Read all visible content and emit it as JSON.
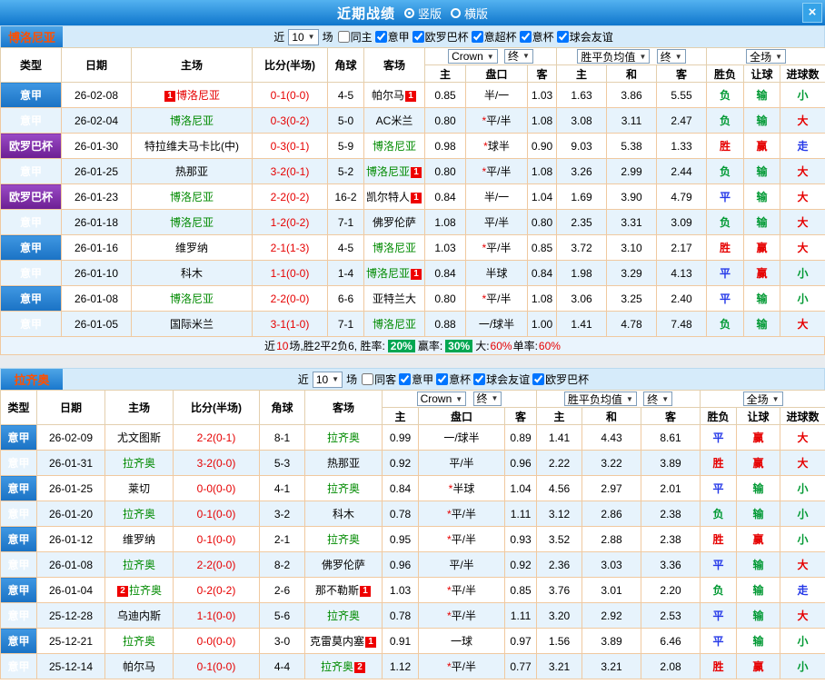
{
  "topbar": {
    "title": "近期战绩",
    "close": "×",
    "options": [
      {
        "label": "竖版",
        "selected": true
      },
      {
        "label": "横版",
        "selected": false
      }
    ]
  },
  "controls": {
    "near": "近",
    "count": "10",
    "games": "场",
    "company": "Crown",
    "final": "终",
    "avg": "胜平负均值",
    "full": "全场"
  },
  "columns": {
    "type": "类型",
    "date": "日期",
    "home": "主场",
    "score": "比分(半场)",
    "corner": "角球",
    "away": "客场",
    "sub": [
      "主",
      "盘口",
      "客",
      "主",
      "和",
      "客",
      "胜负",
      "让球",
      "进球数"
    ]
  },
  "sections": [
    {
      "team": "博洛尼亚",
      "filter": {
        "checkboxes": [
          {
            "label": "同主",
            "checked": false
          },
          {
            "label": "意甲",
            "checked": true
          },
          {
            "label": "欧罗巴杯",
            "checked": true
          },
          {
            "label": "意超杯",
            "checked": true
          },
          {
            "label": "意杯",
            "checked": true
          },
          {
            "label": "球会友谊",
            "checked": true
          }
        ]
      },
      "rows": [
        {
          "league": "意甲",
          "lc": "blue",
          "date": "26-02-08",
          "home": {
            "name": "博洛尼亚",
            "color": "red",
            "badge": "1",
            "badge_pos": "before"
          },
          "score": "0-1(0-0)",
          "corner": "4-5",
          "away": {
            "name": "帕尔马",
            "color": "black",
            "badge": "1",
            "badge_pos": "after"
          },
          "o": [
            "0.85",
            "半/一",
            "1.03"
          ],
          "a": [
            "1.63",
            "3.86",
            "5.55"
          ],
          "r": [
            [
              "负",
              "green"
            ],
            [
              "输",
              "green"
            ],
            [
              "小",
              "green"
            ]
          ]
        },
        {
          "league": "意甲",
          "lc": "blue",
          "date": "26-02-04",
          "home": {
            "name": "博洛尼亚",
            "color": "green"
          },
          "score": "0-3(0-2)",
          "corner": "5-0",
          "away": {
            "name": "AC米兰",
            "color": "black"
          },
          "o": [
            "0.80",
            "*平/半",
            "1.08"
          ],
          "a": [
            "3.08",
            "3.11",
            "2.47"
          ],
          "r": [
            [
              "负",
              "green"
            ],
            [
              "输",
              "green"
            ],
            [
              "大",
              "red"
            ]
          ]
        },
        {
          "league": "欧罗巴杯",
          "lc": "purple",
          "date": "26-01-30",
          "home": {
            "name": "特拉维夫马卡比(中)",
            "color": "black"
          },
          "score": "0-3(0-1)",
          "corner": "5-9",
          "away": {
            "name": "博洛尼亚",
            "color": "green"
          },
          "o": [
            "0.98",
            "*球半",
            "0.90"
          ],
          "a": [
            "9.03",
            "5.38",
            "1.33"
          ],
          "r": [
            [
              "胜",
              "red"
            ],
            [
              "赢",
              "red"
            ],
            [
              "走",
              "blue"
            ]
          ]
        },
        {
          "league": "意甲",
          "lc": "blue",
          "date": "26-01-25",
          "home": {
            "name": "热那亚",
            "color": "black"
          },
          "score": "3-2(0-1)",
          "corner": "5-2",
          "away": {
            "name": "博洛尼亚",
            "color": "green",
            "badge": "1",
            "badge_pos": "after"
          },
          "o": [
            "0.80",
            "*平/半",
            "1.08"
          ],
          "a": [
            "3.26",
            "2.99",
            "2.44"
          ],
          "r": [
            [
              "负",
              "green"
            ],
            [
              "输",
              "green"
            ],
            [
              "大",
              "red"
            ]
          ]
        },
        {
          "league": "欧罗巴杯",
          "lc": "purple",
          "date": "26-01-23",
          "home": {
            "name": "博洛尼亚",
            "color": "green"
          },
          "score": "2-2(0-2)",
          "corner": "16-2",
          "away": {
            "name": "凯尔特人",
            "color": "black",
            "badge": "1",
            "badge_pos": "after"
          },
          "o": [
            "0.84",
            "半/一",
            "1.04"
          ],
          "a": [
            "1.69",
            "3.90",
            "4.79"
          ],
          "r": [
            [
              "平",
              "blue"
            ],
            [
              "输",
              "green"
            ],
            [
              "大",
              "red"
            ]
          ]
        },
        {
          "league": "意甲",
          "lc": "blue",
          "date": "26-01-18",
          "home": {
            "name": "博洛尼亚",
            "color": "green"
          },
          "score": "1-2(0-2)",
          "corner": "7-1",
          "away": {
            "name": "佛罗伦萨",
            "color": "black"
          },
          "o": [
            "1.08",
            "平/半",
            "0.80"
          ],
          "a": [
            "2.35",
            "3.31",
            "3.09"
          ],
          "r": [
            [
              "负",
              "green"
            ],
            [
              "输",
              "green"
            ],
            [
              "大",
              "red"
            ]
          ]
        },
        {
          "league": "意甲",
          "lc": "blue",
          "date": "26-01-16",
          "home": {
            "name": "维罗纳",
            "color": "black"
          },
          "score": "2-1(1-3)",
          "corner": "4-5",
          "away": {
            "name": "博洛尼亚",
            "color": "green"
          },
          "o": [
            "1.03",
            "*平/半",
            "0.85"
          ],
          "a": [
            "3.72",
            "3.10",
            "2.17"
          ],
          "r": [
            [
              "胜",
              "red"
            ],
            [
              "赢",
              "red"
            ],
            [
              "大",
              "red"
            ]
          ]
        },
        {
          "league": "意甲",
          "lc": "blue",
          "date": "26-01-10",
          "home": {
            "name": "科木",
            "color": "black"
          },
          "score": "1-1(0-0)",
          "corner": "1-4",
          "away": {
            "name": "博洛尼亚",
            "color": "green",
            "badge": "1",
            "badge_pos": "after"
          },
          "o": [
            "0.84",
            "半球",
            "0.84"
          ],
          "a": [
            "1.98",
            "3.29",
            "4.13"
          ],
          "r": [
            [
              "平",
              "blue"
            ],
            [
              "赢",
              "red"
            ],
            [
              "小",
              "green"
            ]
          ]
        },
        {
          "league": "意甲",
          "lc": "blue",
          "date": "26-01-08",
          "home": {
            "name": "博洛尼亚",
            "color": "green"
          },
          "score": "2-2(0-0)",
          "corner": "6-6",
          "away": {
            "name": "亚特兰大",
            "color": "black"
          },
          "o": [
            "0.80",
            "*平/半",
            "1.08"
          ],
          "a": [
            "3.06",
            "3.25",
            "2.40"
          ],
          "r": [
            [
              "平",
              "blue"
            ],
            [
              "输",
              "green"
            ],
            [
              "小",
              "green"
            ]
          ]
        },
        {
          "league": "意甲",
          "lc": "blue",
          "date": "26-01-05",
          "home": {
            "name": "国际米兰",
            "color": "black"
          },
          "score": "3-1(1-0)",
          "corner": "7-1",
          "away": {
            "name": "博洛尼亚",
            "color": "green"
          },
          "o": [
            "0.88",
            "一/球半",
            "1.00"
          ],
          "a": [
            "1.41",
            "4.78",
            "7.48"
          ],
          "r": [
            [
              "负",
              "green"
            ],
            [
              "输",
              "green"
            ],
            [
              "大",
              "red"
            ]
          ]
        }
      ],
      "summary": [
        {
          "text": "近",
          "style": "plain"
        },
        {
          "text": "10",
          "style": "red"
        },
        {
          "text": "场,胜2平2负6, 胜率: ",
          "style": "plain"
        },
        {
          "text": "20%",
          "style": "green-box"
        },
        {
          "text": " 赢率: ",
          "style": "plain"
        },
        {
          "text": "30%",
          "style": "green-box"
        },
        {
          "text": " 大:",
          "style": "plain"
        },
        {
          "text": "60%",
          "style": "red"
        },
        {
          "text": " 单率:",
          "style": "plain"
        },
        {
          "text": "60%",
          "style": "red"
        }
      ]
    },
    {
      "team": "拉齐奥",
      "filter": {
        "checkboxes": [
          {
            "label": "同客",
            "checked": false
          },
          {
            "label": "意甲",
            "checked": true
          },
          {
            "label": "意杯",
            "checked": true
          },
          {
            "label": "球会友谊",
            "checked": true
          },
          {
            "label": "欧罗巴杯",
            "checked": true
          }
        ]
      },
      "rows": [
        {
          "league": "意甲",
          "lc": "blue",
          "date": "26-02-09",
          "home": {
            "name": "尤文图斯",
            "color": "black"
          },
          "score": "2-2(0-1)",
          "corner": "8-1",
          "away": {
            "name": "拉齐奥",
            "color": "green"
          },
          "o": [
            "0.99",
            "一/球半",
            "0.89"
          ],
          "a": [
            "1.41",
            "4.43",
            "8.61"
          ],
          "r": [
            [
              "平",
              "blue"
            ],
            [
              "赢",
              "red"
            ],
            [
              "大",
              "red"
            ]
          ]
        },
        {
          "league": "意甲",
          "lc": "blue",
          "date": "26-01-31",
          "home": {
            "name": "拉齐奥",
            "color": "green"
          },
          "score": "3-2(0-0)",
          "corner": "5-3",
          "away": {
            "name": "热那亚",
            "color": "black"
          },
          "o": [
            "0.92",
            "平/半",
            "0.96"
          ],
          "a": [
            "2.22",
            "3.22",
            "3.89"
          ],
          "r": [
            [
              "胜",
              "red"
            ],
            [
              "赢",
              "red"
            ],
            [
              "大",
              "red"
            ]
          ]
        },
        {
          "league": "意甲",
          "lc": "blue",
          "date": "26-01-25",
          "home": {
            "name": "莱切",
            "color": "black"
          },
          "score": "0-0(0-0)",
          "corner": "4-1",
          "away": {
            "name": "拉齐奥",
            "color": "green"
          },
          "o": [
            "0.84",
            "*半球",
            "1.04"
          ],
          "a": [
            "4.56",
            "2.97",
            "2.01"
          ],
          "r": [
            [
              "平",
              "blue"
            ],
            [
              "输",
              "green"
            ],
            [
              "小",
              "green"
            ]
          ]
        },
        {
          "league": "意甲",
          "lc": "blue",
          "date": "26-01-20",
          "home": {
            "name": "拉齐奥",
            "color": "green"
          },
          "score": "0-1(0-0)",
          "corner": "3-2",
          "away": {
            "name": "科木",
            "color": "black"
          },
          "o": [
            "0.78",
            "*平/半",
            "1.11"
          ],
          "a": [
            "3.12",
            "2.86",
            "2.38"
          ],
          "r": [
            [
              "负",
              "green"
            ],
            [
              "输",
              "green"
            ],
            [
              "小",
              "green"
            ]
          ]
        },
        {
          "league": "意甲",
          "lc": "blue",
          "date": "26-01-12",
          "home": {
            "name": "维罗纳",
            "color": "black"
          },
          "score": "0-1(0-0)",
          "corner": "2-1",
          "away": {
            "name": "拉齐奥",
            "color": "green"
          },
          "o": [
            "0.95",
            "*平/半",
            "0.93"
          ],
          "a": [
            "3.52",
            "2.88",
            "2.38"
          ],
          "r": [
            [
              "胜",
              "red"
            ],
            [
              "赢",
              "red"
            ],
            [
              "小",
              "green"
            ]
          ]
        },
        {
          "league": "意甲",
          "lc": "blue",
          "date": "26-01-08",
          "home": {
            "name": "拉齐奥",
            "color": "green"
          },
          "score": "2-2(0-0)",
          "corner": "8-2",
          "away": {
            "name": "佛罗伦萨",
            "color": "black"
          },
          "o": [
            "0.96",
            "平/半",
            "0.92"
          ],
          "a": [
            "2.36",
            "3.03",
            "3.36"
          ],
          "r": [
            [
              "平",
              "blue"
            ],
            [
              "输",
              "green"
            ],
            [
              "大",
              "red"
            ]
          ]
        },
        {
          "league": "意甲",
          "lc": "blue",
          "date": "26-01-04",
          "home": {
            "name": "拉齐奥",
            "color": "green",
            "badge": "2",
            "badge_pos": "before"
          },
          "score": "0-2(0-2)",
          "corner": "2-6",
          "away": {
            "name": "那不勒斯",
            "color": "black",
            "badge": "1",
            "badge_pos": "after"
          },
          "o": [
            "1.03",
            "*平/半",
            "0.85"
          ],
          "a": [
            "3.76",
            "3.01",
            "2.20"
          ],
          "r": [
            [
              "负",
              "green"
            ],
            [
              "输",
              "green"
            ],
            [
              "走",
              "blue"
            ]
          ]
        },
        {
          "league": "意甲",
          "lc": "blue",
          "date": "25-12-28",
          "home": {
            "name": "乌迪内斯",
            "color": "black"
          },
          "score": "1-1(0-0)",
          "corner": "5-6",
          "away": {
            "name": "拉齐奥",
            "color": "green"
          },
          "o": [
            "0.78",
            "*平/半",
            "1.11"
          ],
          "a": [
            "3.20",
            "2.92",
            "2.53"
          ],
          "r": [
            [
              "平",
              "blue"
            ],
            [
              "输",
              "green"
            ],
            [
              "大",
              "red"
            ]
          ]
        },
        {
          "league": "意甲",
          "lc": "blue",
          "date": "25-12-21",
          "home": {
            "name": "拉齐奥",
            "color": "green"
          },
          "score": "0-0(0-0)",
          "corner": "3-0",
          "away": {
            "name": "克雷莫内塞",
            "color": "black",
            "badge": "1",
            "badge_pos": "after"
          },
          "o": [
            "0.91",
            "一球",
            "0.97"
          ],
          "a": [
            "1.56",
            "3.89",
            "6.46"
          ],
          "r": [
            [
              "平",
              "blue"
            ],
            [
              "输",
              "green"
            ],
            [
              "小",
              "green"
            ]
          ]
        },
        {
          "league": "意甲",
          "lc": "blue",
          "date": "25-12-14",
          "home": {
            "name": "帕尔马",
            "color": "black"
          },
          "score": "0-1(0-0)",
          "corner": "4-4",
          "away": {
            "name": "拉齐奥",
            "color": "green",
            "badge": "2",
            "badge_pos": "after"
          },
          "o": [
            "1.12",
            "*平/半",
            "0.77"
          ],
          "a": [
            "3.21",
            "3.21",
            "2.08"
          ],
          "r": [
            [
              "胜",
              "red"
            ],
            [
              "赢",
              "red"
            ],
            [
              "小",
              "green"
            ]
          ]
        }
      ],
      "summary": null
    }
  ]
}
